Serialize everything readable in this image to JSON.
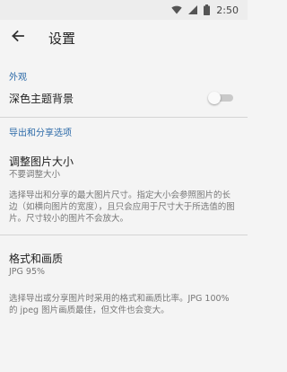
{
  "status_bar": {
    "time": "2:50",
    "icons": [
      "wifi-icon",
      "cellular-signal-icon",
      "battery-icon"
    ]
  },
  "app_bar": {
    "back_icon": "arrow-left-icon",
    "title": "设置"
  },
  "sections": {
    "appearance": {
      "header": "外观",
      "dark_theme_label": "深色主题背景",
      "dark_theme_enabled": false
    },
    "export": {
      "header": "导出和分享选项",
      "resize": {
        "title": "调整图片大小",
        "value": "不要调整大小",
        "description": "选择导出和分享的最大图片尺寸。指定大小会参照图片的长边（如横向图片的宽度），且只会应用于尺寸大于所选值的图片。尺寸较小的图片不会放大。"
      },
      "format": {
        "title": "格式和画质",
        "value": "JPG 95%",
        "description": "选择导出或分享图片时采用的格式和画质比率。JPG 100% 的 jpeg 图片画质最佳，但文件也会变大。"
      }
    }
  },
  "colors": {
    "accent": "#2c6aa8",
    "background": "#f4f4f4",
    "switch_track": "#c9c9c9"
  }
}
